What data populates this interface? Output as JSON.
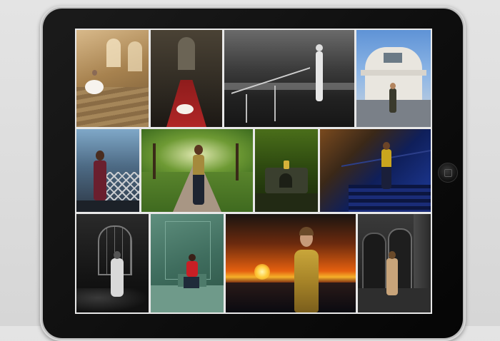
{
  "scene": {
    "background_color": "#dcdcdc",
    "device": "tablet",
    "device_color": "#111111",
    "gallery": {
      "rows": 3,
      "photos": [
        {
          "subject": "ballerina-stone-staircase"
        },
        {
          "subject": "ballerina-red-carpet-gothic-hall"
        },
        {
          "subject": "dancer-bw-waterfront-railing"
        },
        {
          "subject": "woman-art-deco-house"
        },
        {
          "subject": "woman-bridge-railing"
        },
        {
          "subject": "woman-tree-lined-path"
        },
        {
          "subject": "figure-forest-night"
        },
        {
          "subject": "woman-blue-stairs-night"
        },
        {
          "subject": "woman-bw-window"
        },
        {
          "subject": "woman-red-jacket-green-room"
        },
        {
          "subject": "woman-gold-dress-sunset"
        },
        {
          "subject": "woman-gothic-doorway-night"
        }
      ]
    }
  }
}
